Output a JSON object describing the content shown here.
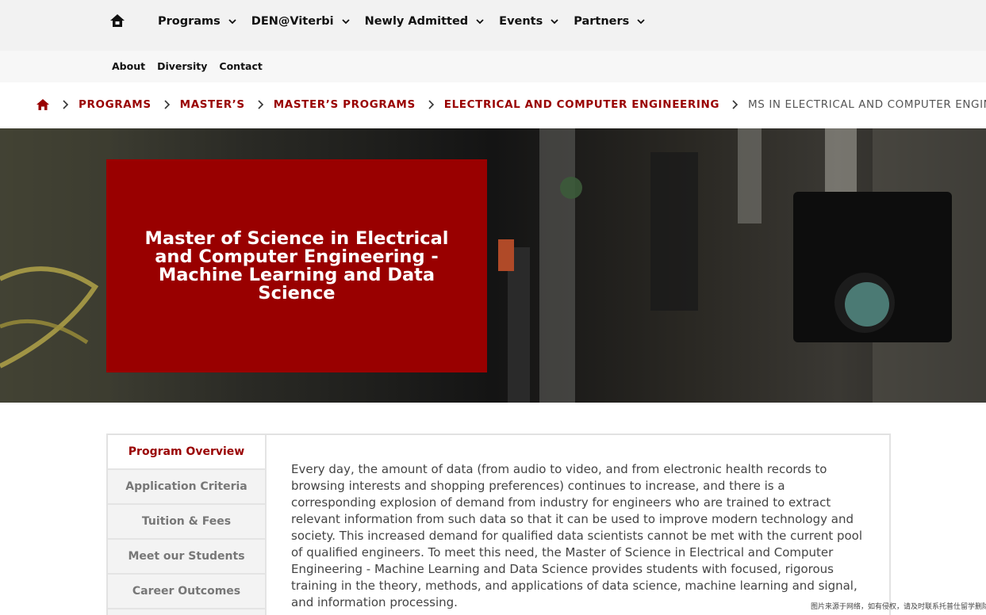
{
  "topnav": {
    "home_icon": "home-icon",
    "items": [
      {
        "label": "Programs"
      },
      {
        "label": "DEN@Viterbi"
      },
      {
        "label": "Newly Admitted"
      },
      {
        "label": "Events"
      },
      {
        "label": "Partners"
      }
    ]
  },
  "subnav": {
    "items": [
      {
        "label": "About"
      },
      {
        "label": "Diversity"
      },
      {
        "label": "Contact"
      }
    ]
  },
  "breadcrumb": {
    "home_icon": "home-icon",
    "items": [
      {
        "label": "PROGRAMS"
      },
      {
        "label": "MASTER’S"
      },
      {
        "label": "MASTER’S PROGRAMS"
      },
      {
        "label": "ELECTRICAL AND COMPUTER ENGINEERING"
      }
    ],
    "current": "MS IN ELECTRICAL AND COMPUTER ENGINEERING –"
  },
  "hero": {
    "title": "Master of Science in Electrical and Computer Engineering - Machine Learning and Data Science"
  },
  "tabs": [
    {
      "label": "Program Overview",
      "active": true
    },
    {
      "label": "Application Criteria",
      "active": false
    },
    {
      "label": "Tuition & Fees",
      "active": false
    },
    {
      "label": "Meet our Students",
      "active": false
    },
    {
      "label": "Career Outcomes",
      "active": false
    }
  ],
  "overview": {
    "text": "Every day, the amount of data (from audio to video, and from electronic health records to browsing interests and shopping preferences) continues to increase, and there is a corresponding explosion of demand from industry for engineers who are trained to extract relevant information from such data so that it can be used to improve modern technology and society. This increased demand for qualified data scientists cannot be met with the current pool of qualified engineers. To meet this need, the Master of Science in  Electrical and Computer Engineering - Machine Learning and Data Science provides students with focused, rigorous training in the theory, methods, and applications of data science, machine learning and signal, and information processing."
  },
  "watermark": "图片来源于网络，如有侵权，请及时联系托普仕留学删除",
  "colors": {
    "brand": "#990000",
    "nav_bg": "#f2f2f2",
    "tab_bg": "#f3f3f3"
  }
}
